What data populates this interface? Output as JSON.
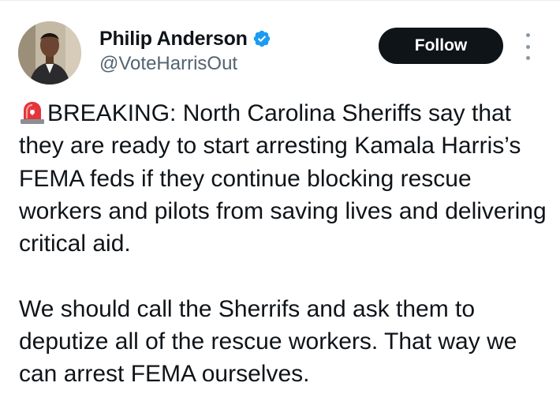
{
  "author": {
    "name": "Philip Anderson",
    "handle": "@VoteHarrisOut",
    "verified": true,
    "verified_color": "#1d9bf0"
  },
  "actions": {
    "follow_label": "Follow",
    "more_icon": "more-vertical-icon"
  },
  "tweet": {
    "emoji_icon": "police-siren-icon",
    "paragraph1": "BREAKING: North Carolina Sheriffs say that they are ready to start arresting Kamala Harris’s FEMA feds if they continue blocking rescue workers and pilots from saving lives and delivering critical aid.",
    "paragraph2": "We should call the Sherrifs and ask them to deputize all of the rescue workers. That way we can arrest FEMA ourselves."
  },
  "colors": {
    "text": "#0f1419",
    "secondary": "#536471",
    "button_bg": "#0f1419",
    "button_text": "#ffffff"
  }
}
